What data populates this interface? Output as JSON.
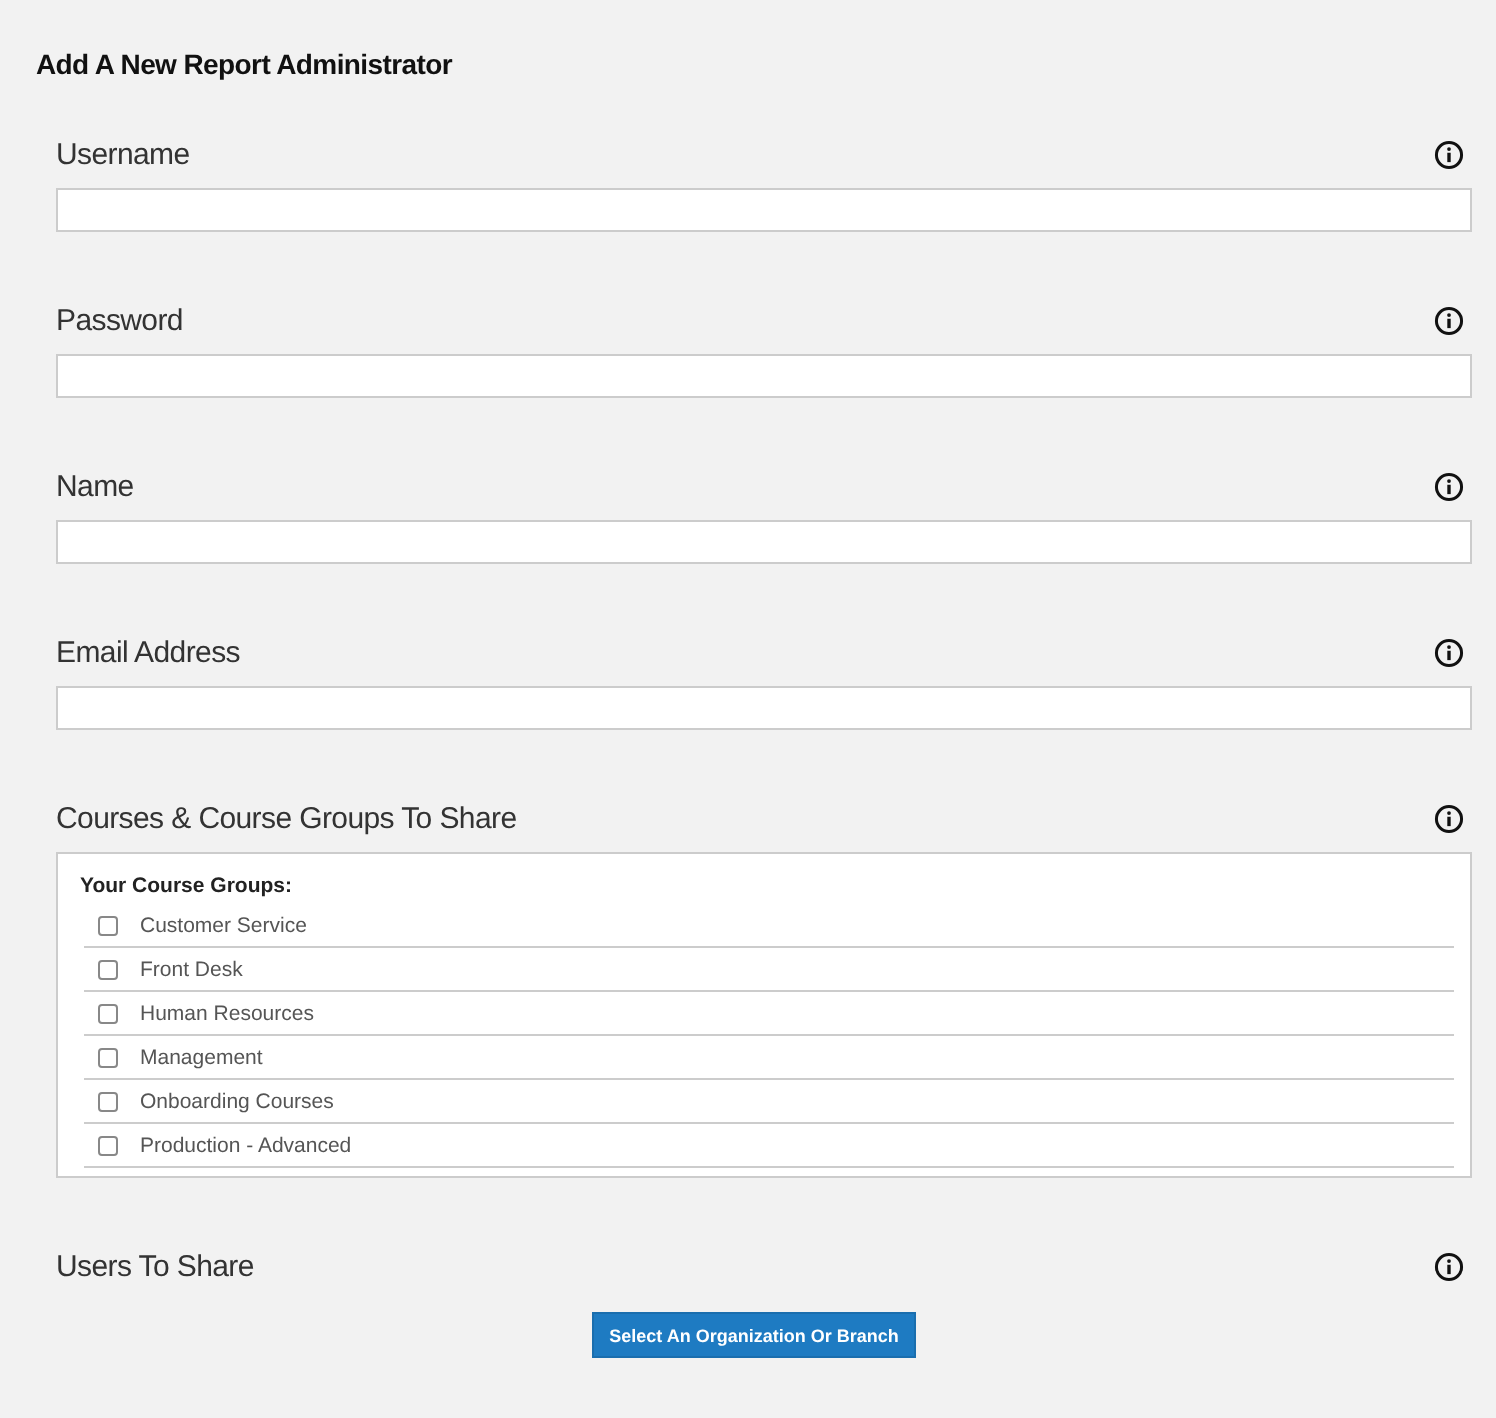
{
  "title": "Add A New Report Administrator",
  "fields": [
    {
      "label": "Username"
    },
    {
      "label": "Password"
    },
    {
      "label": "Name"
    },
    {
      "label": "Email Address"
    }
  ],
  "courses": {
    "label": "Courses & Course Groups To Share",
    "group_heading": "Your Course Groups:",
    "items": [
      {
        "label": "Customer Service",
        "checked": false
      },
      {
        "label": "Front Desk",
        "checked": false
      },
      {
        "label": "Human Resources",
        "checked": false
      },
      {
        "label": "Management",
        "checked": false
      },
      {
        "label": "Onboarding Courses",
        "checked": false
      },
      {
        "label": "Production - Advanced",
        "checked": false
      }
    ]
  },
  "users": {
    "label": "Users To Share",
    "button": "Select An Organization Or Branch"
  }
}
